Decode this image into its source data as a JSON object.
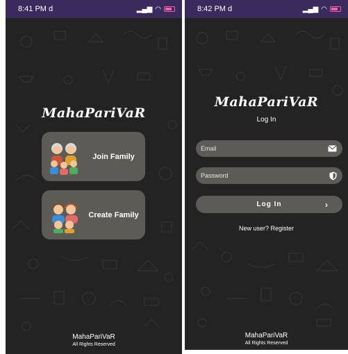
{
  "left_screen": {
    "status": {
      "time": "8:41 PM",
      "carrier_glyph": "d"
    },
    "app_title": "MahaPariVaR",
    "join_card": {
      "label": "Join Family",
      "icon": "family-icon"
    },
    "create_card": {
      "label": "Create Family",
      "icon": "family-icon"
    },
    "footer": {
      "name": "MahaPariVaR",
      "rights": "All Rights Reserved"
    }
  },
  "right_screen": {
    "status": {
      "time": "8:42 PM",
      "carrier_glyph": "d"
    },
    "app_title": "MahaPariVaR",
    "heading": "Log In",
    "email": {
      "placeholder": "Email",
      "icon": "mail-icon"
    },
    "password": {
      "placeholder": "Password",
      "icon": "shield-icon"
    },
    "login_button": {
      "label": "Log In",
      "icon": "chevron-right-icon"
    },
    "register_text": "New user? Register",
    "footer": {
      "name": "MahaPariVaR",
      "rights": "All Rights Reserved"
    }
  },
  "colors": {
    "background": "#232323",
    "card": "#5c5b56",
    "status_bar": "#3b2a5e",
    "battery": "#ff5fa8",
    "text": "#ffffff"
  }
}
